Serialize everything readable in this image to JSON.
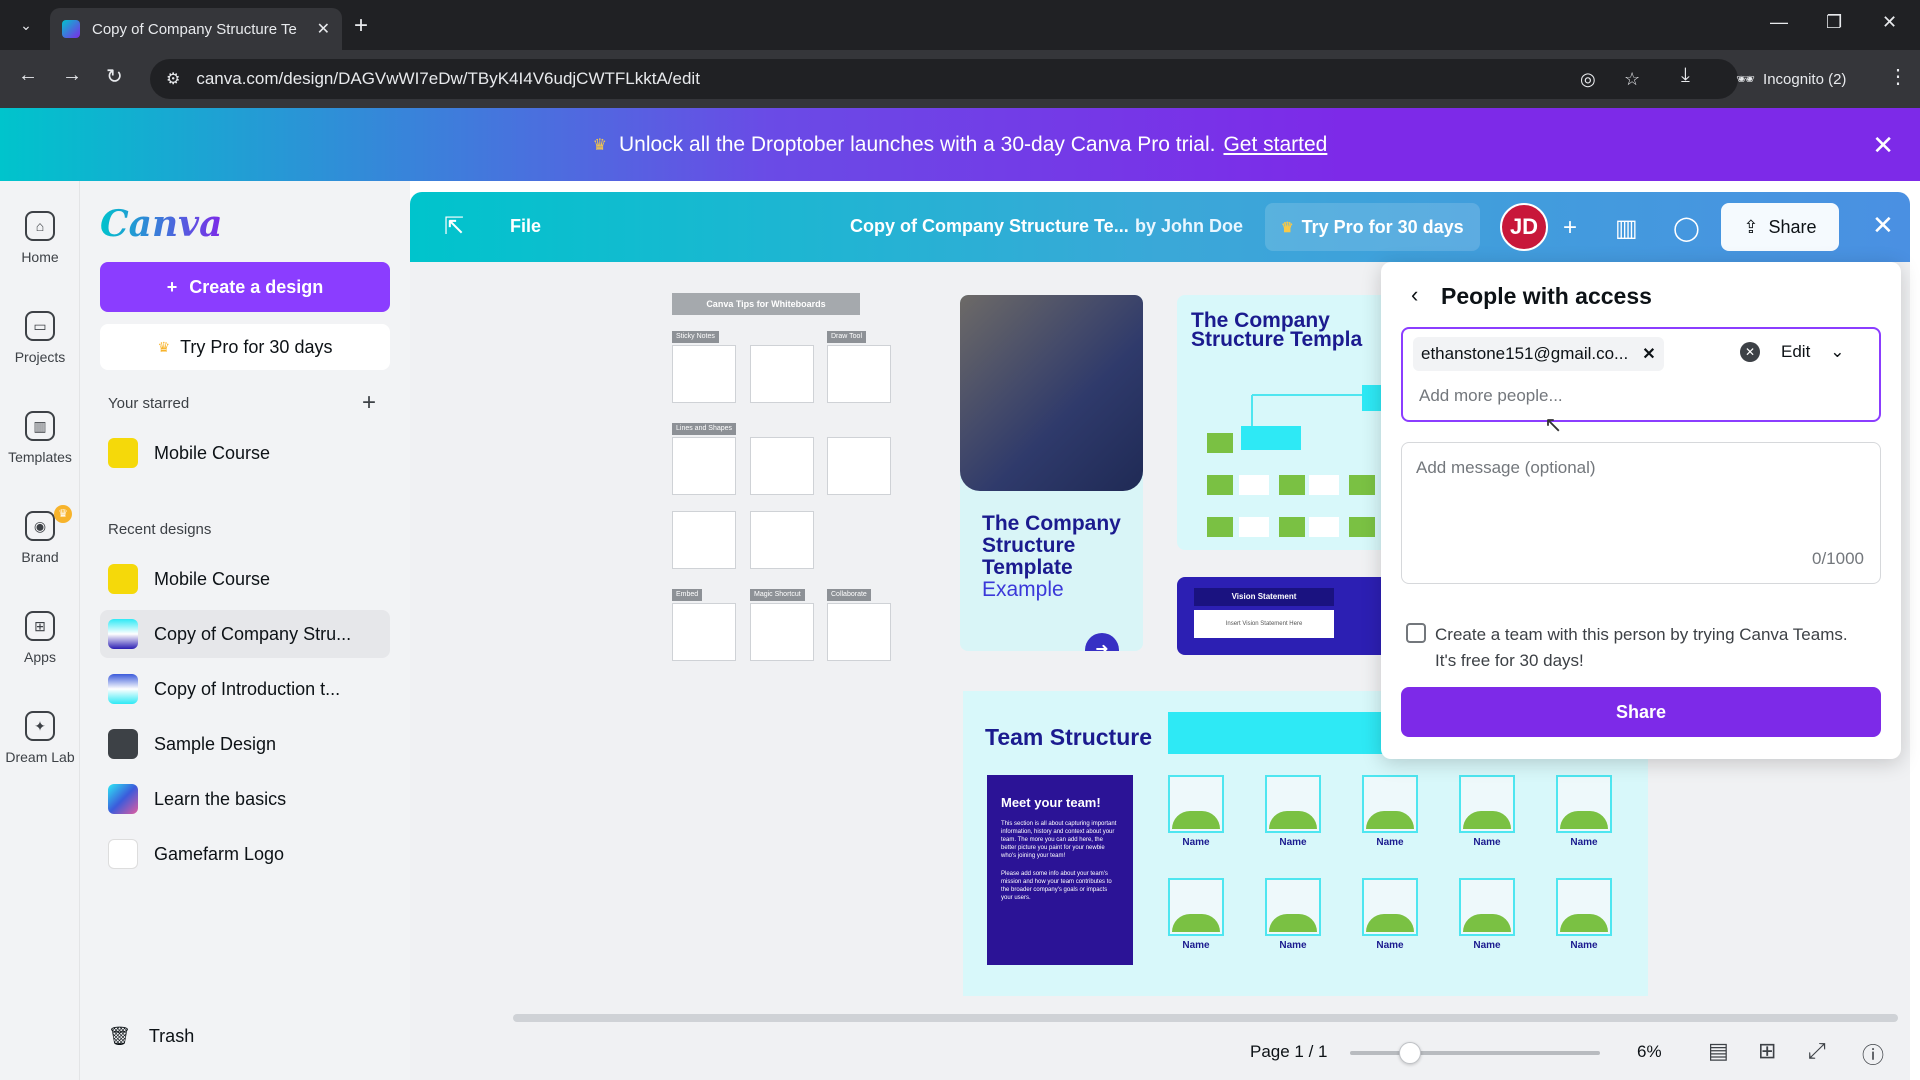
{
  "browser": {
    "tab_title": "Copy of Company Structure Te",
    "url": "canva.com/design/DAGVwWI7eDw/TByK4I4V6udjCWTFLkktA/edit",
    "incognito_label": "Incognito (2)"
  },
  "banner": {
    "text": "Unlock all the Droptober launches with a 30-day Canva Pro trial.",
    "link": "Get started"
  },
  "rail": {
    "items": [
      {
        "label": "Home",
        "icon": "home-icon"
      },
      {
        "label": "Projects",
        "icon": "folder-icon"
      },
      {
        "label": "Templates",
        "icon": "templates-icon"
      },
      {
        "label": "Brand",
        "icon": "brand-icon"
      },
      {
        "label": "Apps",
        "icon": "apps-icon"
      },
      {
        "label": "Dream Lab",
        "icon": "dream-lab-icon"
      }
    ]
  },
  "sidebar": {
    "logo": "Canva",
    "create_label": "Create a design",
    "try_pro_label": "Try Pro for 30 days",
    "starred_label": "Your starred",
    "starred": [
      {
        "label": "Mobile Course"
      }
    ],
    "recent_label": "Recent designs",
    "recent": [
      {
        "label": "Mobile Course"
      },
      {
        "label": "Copy of Company Stru..."
      },
      {
        "label": "Copy of Introduction t..."
      },
      {
        "label": "Sample Design"
      },
      {
        "label": "Learn the basics"
      },
      {
        "label": "Gamefarm Logo"
      }
    ],
    "trash_label": "Trash"
  },
  "editor": {
    "file_label": "File",
    "doc_title": "Copy of Company Structure Te...",
    "author": "by John Doe",
    "try_pro_label": "Try Pro for 30 days",
    "avatar_initials": "JD",
    "share_label": "Share"
  },
  "canvas": {
    "tips_header": "Canva Tips for Whiteboards",
    "tips_labels": [
      "Sticky Notes",
      "Draw Tool",
      "Lines and Shapes",
      "Embed",
      "Magic Shortcut",
      "Collaborate"
    ],
    "cover_title": "The Company Structure Template",
    "cover_subtitle": "Example",
    "company_title": "The Company Structure Templa",
    "vision_label": "Vision Statement",
    "vision_body": "Insert Vision Statement Here",
    "team_title": "Team Structure",
    "meet_title": "Meet your team!",
    "meet_p1": "This section is all about capturing important information, history and context about your team. The more you can add here, the better picture you paint for your newbie who's joining your team!",
    "meet_p2": "Please add some info about your team's mission and how your team contributes to the broader company's goals or impacts your users.",
    "member_name": "Name"
  },
  "share_panel": {
    "title": "People with access",
    "invitee": "ethanstone151@gmail.co...",
    "permission": "Edit",
    "add_placeholder": "Add more people...",
    "message_placeholder": "Add message (optional)",
    "char_count": "0/1000",
    "team_checkbox_text": "Create a team with this person by trying Canva Teams. It's free for 30 days!",
    "share_button": "Share"
  },
  "bottom": {
    "page_info": "Page 1 / 1",
    "zoom": "6%",
    "zoom_level": 0.24
  }
}
